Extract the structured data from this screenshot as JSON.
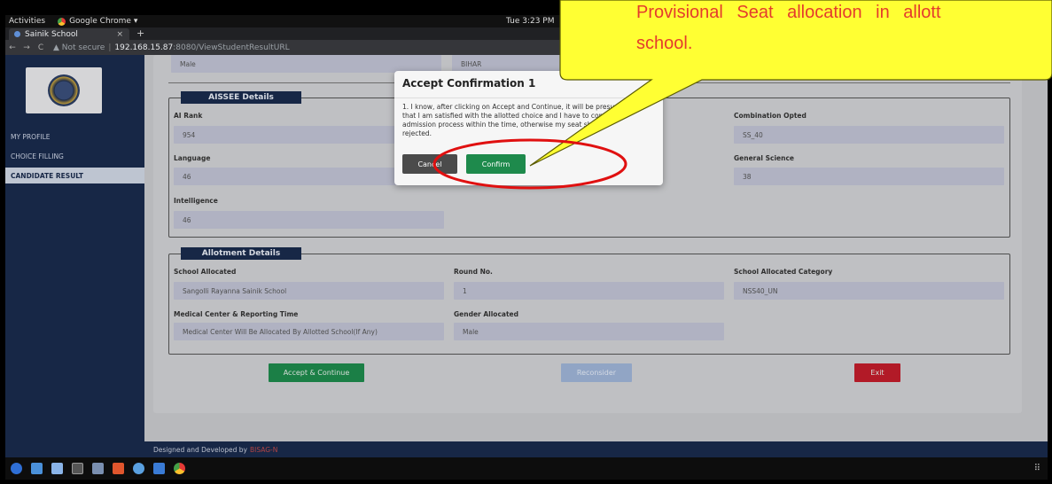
{
  "os": {
    "activities": "Activities",
    "app_name": "Google Chrome ▾",
    "clock": "Tue 3:23 PM"
  },
  "browser": {
    "tab_title": "Sainik School",
    "close_glyph": "×",
    "new_tab_glyph": "+",
    "back_glyph": "←",
    "forward_glyph": "→",
    "reload_glyph": "C",
    "security_label": "▲ Not secure",
    "url_host": "192.168.15.87",
    "url_path": ":8080/ViewStudentResultURL"
  },
  "sidebar": {
    "items": [
      {
        "label": "MY PROFILE"
      },
      {
        "label": "CHOICE FILLING"
      },
      {
        "label": "CANDIDATE RESULT"
      }
    ]
  },
  "top_row": {
    "gender": "Male",
    "state": "BIHAR"
  },
  "aissee": {
    "legend": "AISSEE Details",
    "ai_rank_label": "AI Rank",
    "ai_rank_value": "954",
    "combination_label": "Combination Opted",
    "combination_value": "SS_40",
    "language_label": "Language",
    "language_value": "46",
    "general_science_label": "General Science",
    "general_science_value": "38",
    "intelligence_label": "Intelligence",
    "intelligence_value": "46"
  },
  "allotment": {
    "legend": "Allotment Details",
    "school_label": "School Allocated",
    "school_value": "Sangolli Rayanna Sainik School",
    "round_label": "Round No.",
    "round_value": "1",
    "category_label": "School Allocated Category",
    "category_value": "NSS40_UN",
    "medical_label": "Medical Center & Reporting Time",
    "medical_value": "Medical Center Will Be Allocated By Allotted School(If Any)",
    "gender_label": "Gender Allocated",
    "gender_value": "Male"
  },
  "actions": {
    "accept": "Accept & Continue",
    "reconsider": "Reconsider",
    "exit": "Exit"
  },
  "footer": {
    "text": "Designed and Developed by",
    "brand": "BISAG-N"
  },
  "modal": {
    "title": "Accept Confirmation 1",
    "body": "1. I know, after clicking on Accept and Continue, it will be presumed that I am satisfied with the allotted choice and I have to complete admission process within the time, otherwise my seat shall be rejected.",
    "cancel": "Cancel",
    "confirm": "Confirm"
  },
  "callout": {
    "line1": "Provisional Seat allocation in allott",
    "line2": "school."
  },
  "taskbar": {
    "grid_glyph": "⠿"
  },
  "colors": {
    "sidebar_bg": "#1a2b4d",
    "accept_green": "#1e8a4c",
    "reconsider_blue": "#9eb3d6",
    "exit_red": "#c21d2b",
    "callout_yellow": "#ffff33",
    "callout_text": "#e43b2d",
    "highlight_ring": "#e01010"
  }
}
